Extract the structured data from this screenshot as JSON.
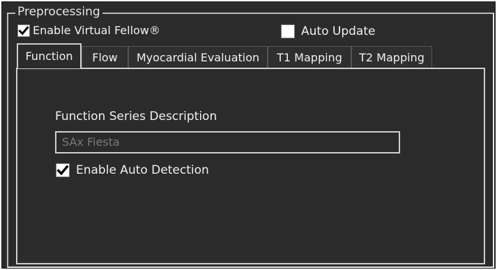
{
  "group": {
    "title": "Preprocessing"
  },
  "options": {
    "enable_virtual_fellow": {
      "label": "Enable Virtual Fellow®",
      "checked": true
    },
    "auto_update": {
      "label": "Auto Update",
      "checked": false
    }
  },
  "tabs": [
    {
      "label": "Function",
      "active": true
    },
    {
      "label": "Flow",
      "active": false
    },
    {
      "label": "Myocardial Evaluation",
      "active": false
    },
    {
      "label": "T1 Mapping",
      "active": false
    },
    {
      "label": "T2 Mapping",
      "active": false
    }
  ],
  "function_tab": {
    "series_description_label": "Function Series Description",
    "series_description_value": "SAx Fiesta",
    "auto_detection": {
      "label": "Enable Auto Detection",
      "checked": true
    }
  },
  "colors": {
    "panel_background": "#2b2b2b",
    "text": "#f0f0f0",
    "disabled_text": "#7a7a7a",
    "border": "#cfcfcf"
  }
}
